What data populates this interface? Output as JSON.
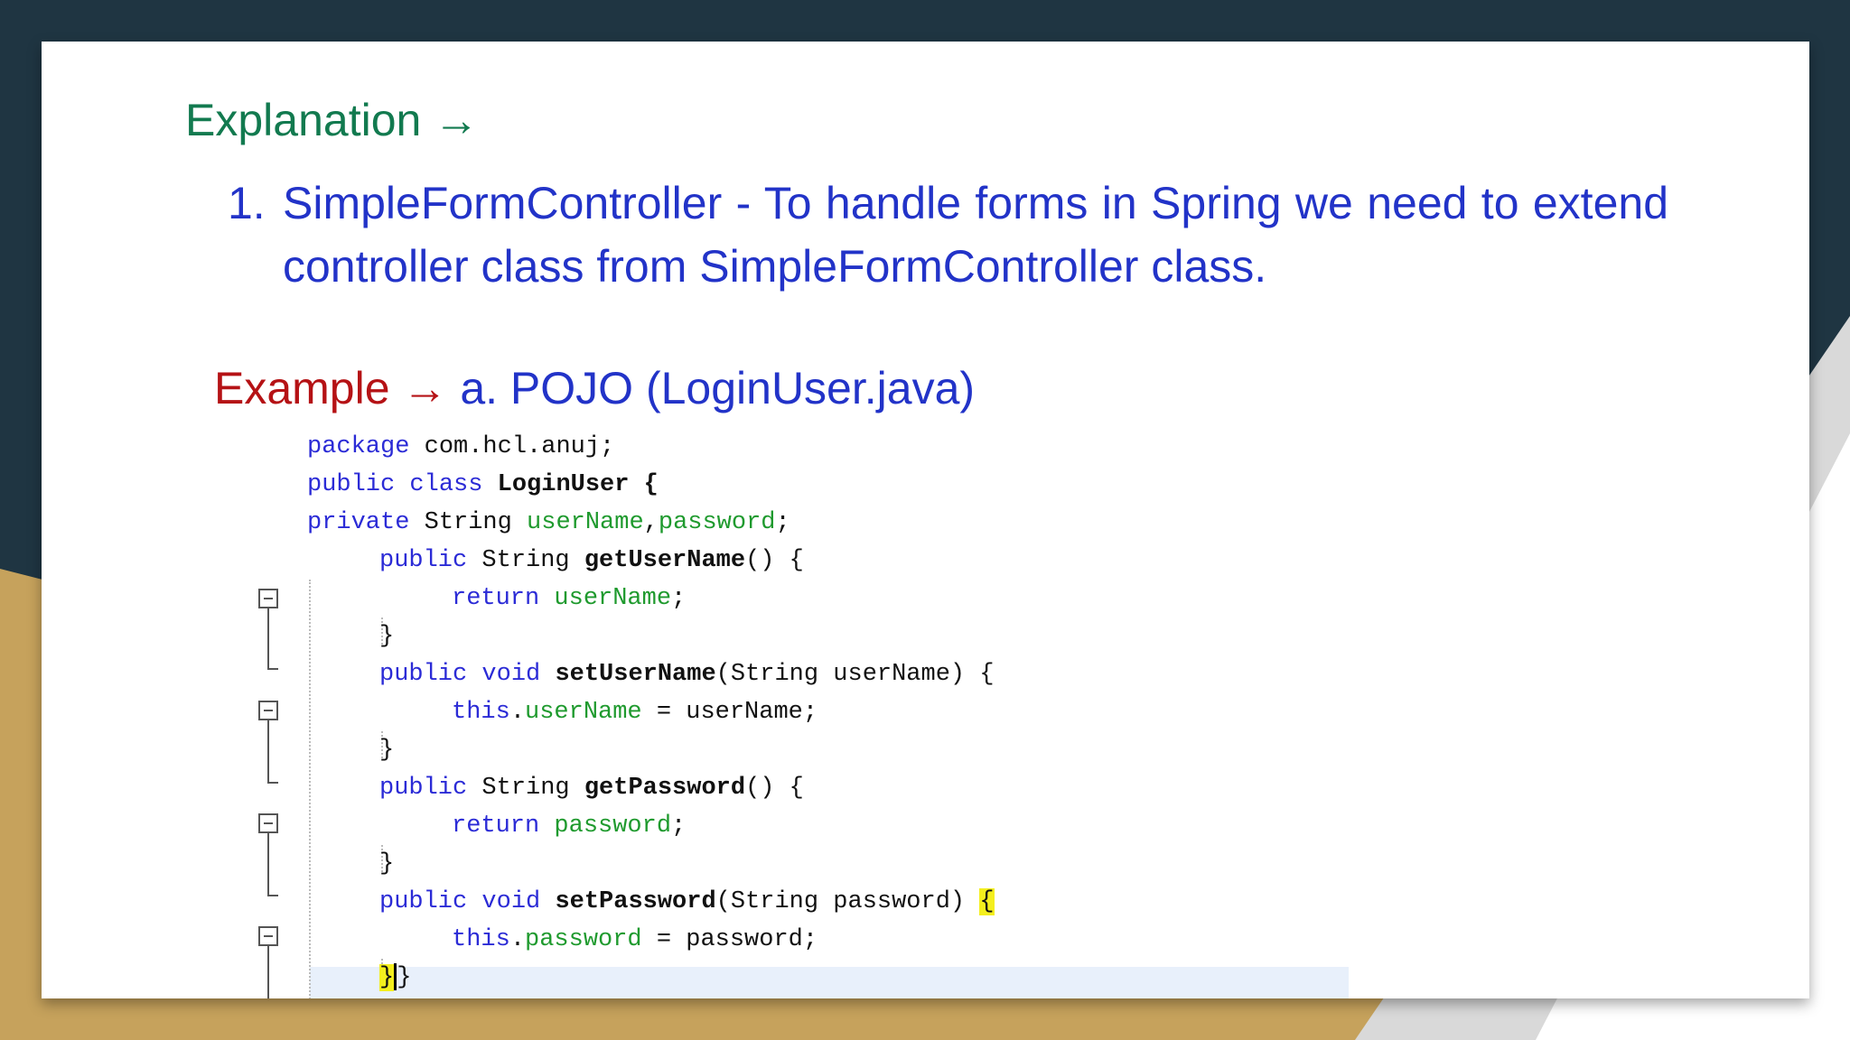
{
  "explanation": {
    "heading": "Explanation →",
    "number": "1.",
    "text": "SimpleFormController - To handle forms in Spring we need to extend controller class from SimpleFormController class."
  },
  "example": {
    "label": "Example",
    "arrow": "→",
    "title": "a. POJO (LoginUser.java)"
  },
  "code": {
    "l1_kw": "package",
    "l1_rest": " com.hcl.anuj;",
    "l2_kw": "public class",
    "l2_rest": " LoginUser {",
    "l3_kw": "private",
    "l3_type": " String ",
    "l3_f1": "userName",
    "l3_comma": ",",
    "l3_f2": "password",
    "l3_end": ";",
    "m1_kw": "public",
    "m1_type": " String ",
    "m1_name": "getUserName",
    "m1_end": "() {",
    "m1_body_kw": "return",
    "m1_body_f": " userName",
    "m1_body_end": ";",
    "close": "}",
    "m2_kw": "public void",
    "m2_sp": " ",
    "m2_name": "setUserName",
    "m2_end": "(String userName) {",
    "m2_body_kw": "this",
    "m2_body_dot": ".",
    "m2_body_f": "userName",
    "m2_body_end": " = userName;",
    "m3_kw": "public",
    "m3_type": " String ",
    "m3_name": "getPassword",
    "m3_end": "() {",
    "m3_body_kw": "return",
    "m3_body_f": " password",
    "m3_body_end": ";",
    "m4_kw": "public void",
    "m4_sp": " ",
    "m4_name": "setPassword",
    "m4_end": "(String password) ",
    "m4_brace": "{",
    "m4_body_kw": "this",
    "m4_body_dot": ".",
    "m4_body_f": "password",
    "m4_body_end": " = password;",
    "last_brace": "}",
    "last_brace2": "}"
  }
}
